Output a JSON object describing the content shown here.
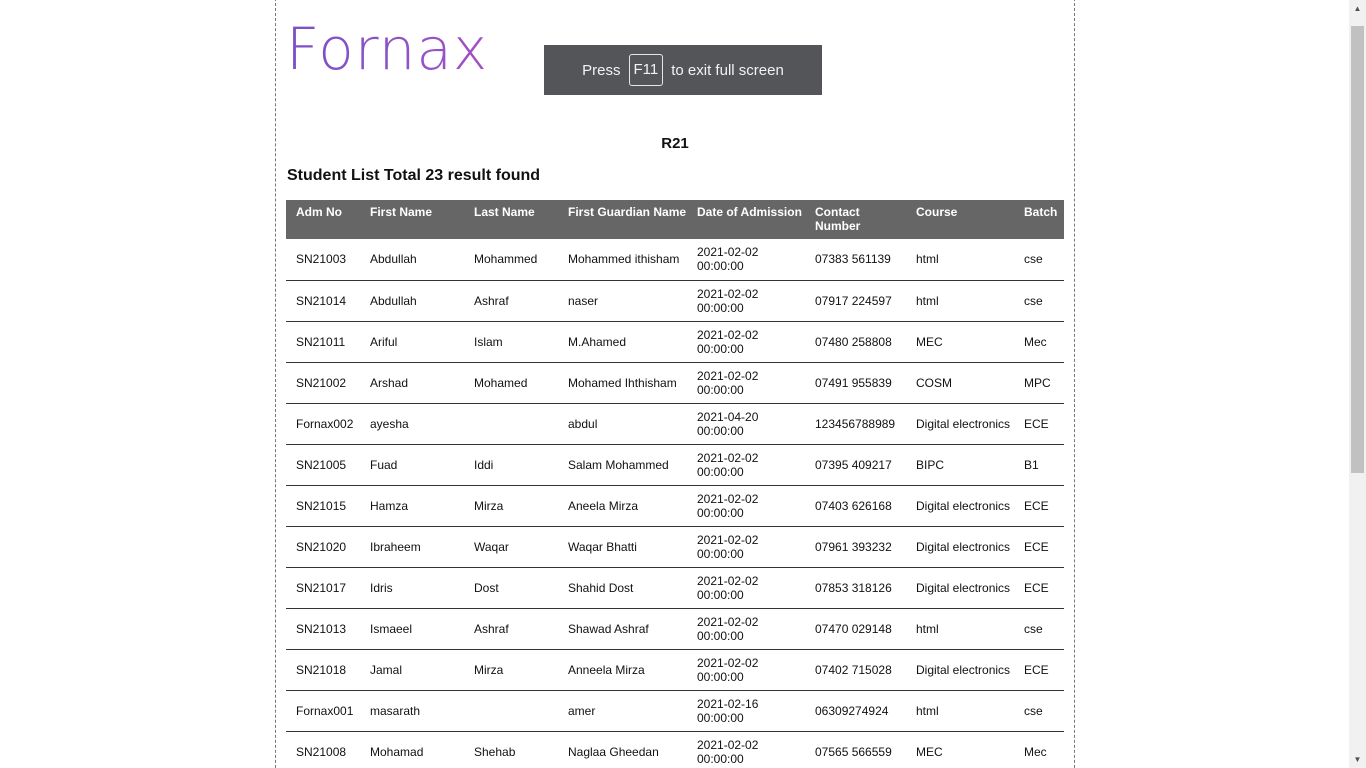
{
  "brand": {
    "logo_text": "Fornax",
    "logo_colors": [
      "#7b4fc6",
      "#a24fc3"
    ]
  },
  "fullscreen_banner": {
    "prefix": "Press",
    "key": "F11",
    "suffix": "to exit full screen"
  },
  "report": {
    "heading": "R21",
    "list_title": "Student List Total 23 result found"
  },
  "table": {
    "columns": [
      "Adm No",
      "First Name",
      "Last Name",
      "First Guardian Name",
      "Date of Admission",
      "Contact Number",
      "Course",
      "Batch"
    ],
    "rows": [
      [
        "SN21003",
        "Abdullah",
        "Mohammed",
        "Mohammed ithisham",
        "2021-02-02 00:00:00",
        "07383 561139",
        "html",
        "cse"
      ],
      [
        "SN21014",
        "Abdullah",
        "Ashraf",
        "naser",
        "2021-02-02 00:00:00",
        "07917 224597",
        "html",
        "cse"
      ],
      [
        "SN21011",
        "Ariful",
        "Islam",
        "M.Ahamed",
        "2021-02-02 00:00:00",
        "07480 258808",
        "MEC",
        "Mec"
      ],
      [
        "SN21002",
        "Arshad",
        "Mohamed",
        "Mohamed Ihthisham",
        "2021-02-02 00:00:00",
        "07491 955839",
        "COSM",
        "MPC"
      ],
      [
        "Fornax002",
        "ayesha",
        "",
        "abdul",
        "2021-04-20 00:00:00",
        "123456788989",
        "Digital electronics",
        "ECE"
      ],
      [
        "SN21005",
        "Fuad",
        "Iddi",
        "Salam Mohammed",
        "2021-02-02 00:00:00",
        "07395 409217",
        "BIPC",
        "B1"
      ],
      [
        "SN21015",
        "Hamza",
        "Mirza",
        "Aneela Mirza",
        "2021-02-02 00:00:00",
        "07403 626168",
        "Digital electronics",
        "ECE"
      ],
      [
        "SN21020",
        "Ibraheem",
        "Waqar",
        "Waqar Bhatti",
        "2021-02-02 00:00:00",
        "07961 393232",
        "Digital electronics",
        "ECE"
      ],
      [
        "SN21017",
        "Idris",
        "Dost",
        "Shahid Dost",
        "2021-02-02 00:00:00",
        "07853 318126",
        "Digital electronics",
        "ECE"
      ],
      [
        "SN21013",
        "Ismaeel",
        "Ashraf",
        "Shawad Ashraf",
        "2021-02-02 00:00:00",
        "07470 029148",
        "html",
        "cse"
      ],
      [
        "SN21018",
        "Jamal",
        "Mirza",
        "Anneela Mirza",
        "2021-02-02 00:00:00",
        "07402 715028",
        "Digital electronics",
        "ECE"
      ],
      [
        "Fornax001",
        "masarath",
        "",
        "amer",
        "2021-02-16 00:00:00",
        "06309274924",
        "html",
        "cse"
      ],
      [
        "SN21008",
        "Mohamad",
        "Shehab",
        "Naglaa Gheedan",
        "2021-02-02 00:00:00",
        "07565 566559",
        "MEC",
        "Mec"
      ]
    ]
  },
  "scrollbar": {
    "up_icon": "triangle-up-icon",
    "down_icon": "triangle-down-icon"
  }
}
